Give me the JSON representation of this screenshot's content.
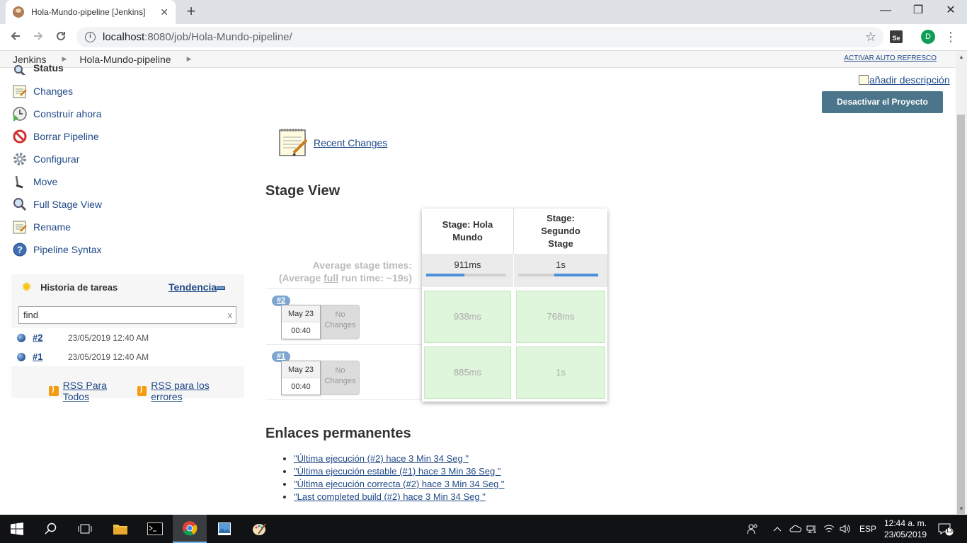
{
  "browser": {
    "tab_title": "Hola-Mundo-pipeline [Jenkins]",
    "tab_close": "✕",
    "new_tab": "+",
    "url_host": "localhost",
    "url_path": ":8080/job/Hola-Mundo-pipeline/",
    "ext_label": "Se",
    "profile_initial": "D",
    "window_minimize": "—",
    "window_restore": "❐",
    "window_close": "✕"
  },
  "breadcrumb": {
    "items": [
      "Jenkins",
      "Hola-Mundo-pipeline"
    ],
    "auto_refresh": "ACTIVAR AUTO REFRESCO"
  },
  "sidebar": {
    "items": [
      {
        "label": "Status",
        "icon": "magnifier-icon"
      },
      {
        "label": "Changes",
        "icon": "notepad-icon"
      },
      {
        "label": "Construir ahora",
        "icon": "clock-play-icon"
      },
      {
        "label": "Borrar Pipeline",
        "icon": "no-entry-icon"
      },
      {
        "label": "Configurar",
        "icon": "gear-icon"
      },
      {
        "label": "Move",
        "icon": "wrench-icon"
      },
      {
        "label": "Full Stage View",
        "icon": "magnifier-icon"
      },
      {
        "label": "Rename",
        "icon": "notepad-icon"
      },
      {
        "label": "Pipeline Syntax",
        "icon": "help-icon"
      }
    ]
  },
  "build_history": {
    "title": "Historia de tareas",
    "trend": "Tendencia",
    "search_value": "find",
    "search_clear": "x",
    "builds": [
      {
        "number": "#2",
        "date": "23/05/2019 12:40 AM"
      },
      {
        "number": "#1",
        "date": "23/05/2019 12:40 AM"
      }
    ],
    "rss_all": "RSS Para Todos",
    "rss_failures": "RSS para los errores"
  },
  "main": {
    "add_description": "añadir descripción",
    "disable_button": "Desactivar el Proyecto",
    "recent_changes": "Recent Changes",
    "stage_view_title": "Stage View",
    "avg_times_label": "Average stage times:",
    "avg_full_prefix": "(Average ",
    "avg_full_word": "full",
    "avg_full_suffix": " run time: ~19s)",
    "stages": [
      {
        "name": "Stage: Hola Mundo",
        "avg": "911ms",
        "avg_fraction": 0.48
      },
      {
        "name": "Stage: Segundo Stage",
        "avg": "1s",
        "avg_fraction": 0.55
      }
    ],
    "runs": [
      {
        "badge": "#2",
        "date": "May 23",
        "time": "00:40",
        "changes": "No Changes",
        "durations": [
          "938ms",
          "768ms"
        ]
      },
      {
        "badge": "#1",
        "date": "May 23",
        "time": "00:40",
        "changes": "No Changes",
        "durations": [
          "885ms",
          "1s"
        ]
      }
    ],
    "permalinks_title": "Enlaces permanentes",
    "permalinks": [
      "\"Última ejecución (#2) hace 3 Min 34 Seg \"",
      "\"Última ejecución estable (#1) hace 3 Min 36 Seg \"",
      "\"Última ejecución correcta (#2) hace 3 Min 34 Seg \"",
      "\"Last completed build (#2) hace 3 Min 34 Seg \""
    ]
  },
  "taskbar": {
    "language": "ESP",
    "time": "12:44 a. m.",
    "date": "23/05/2019",
    "notification_count": "13"
  },
  "colors": {
    "link": "#204a87",
    "button": "#4b758b",
    "stage_success": "#dff5dc"
  }
}
